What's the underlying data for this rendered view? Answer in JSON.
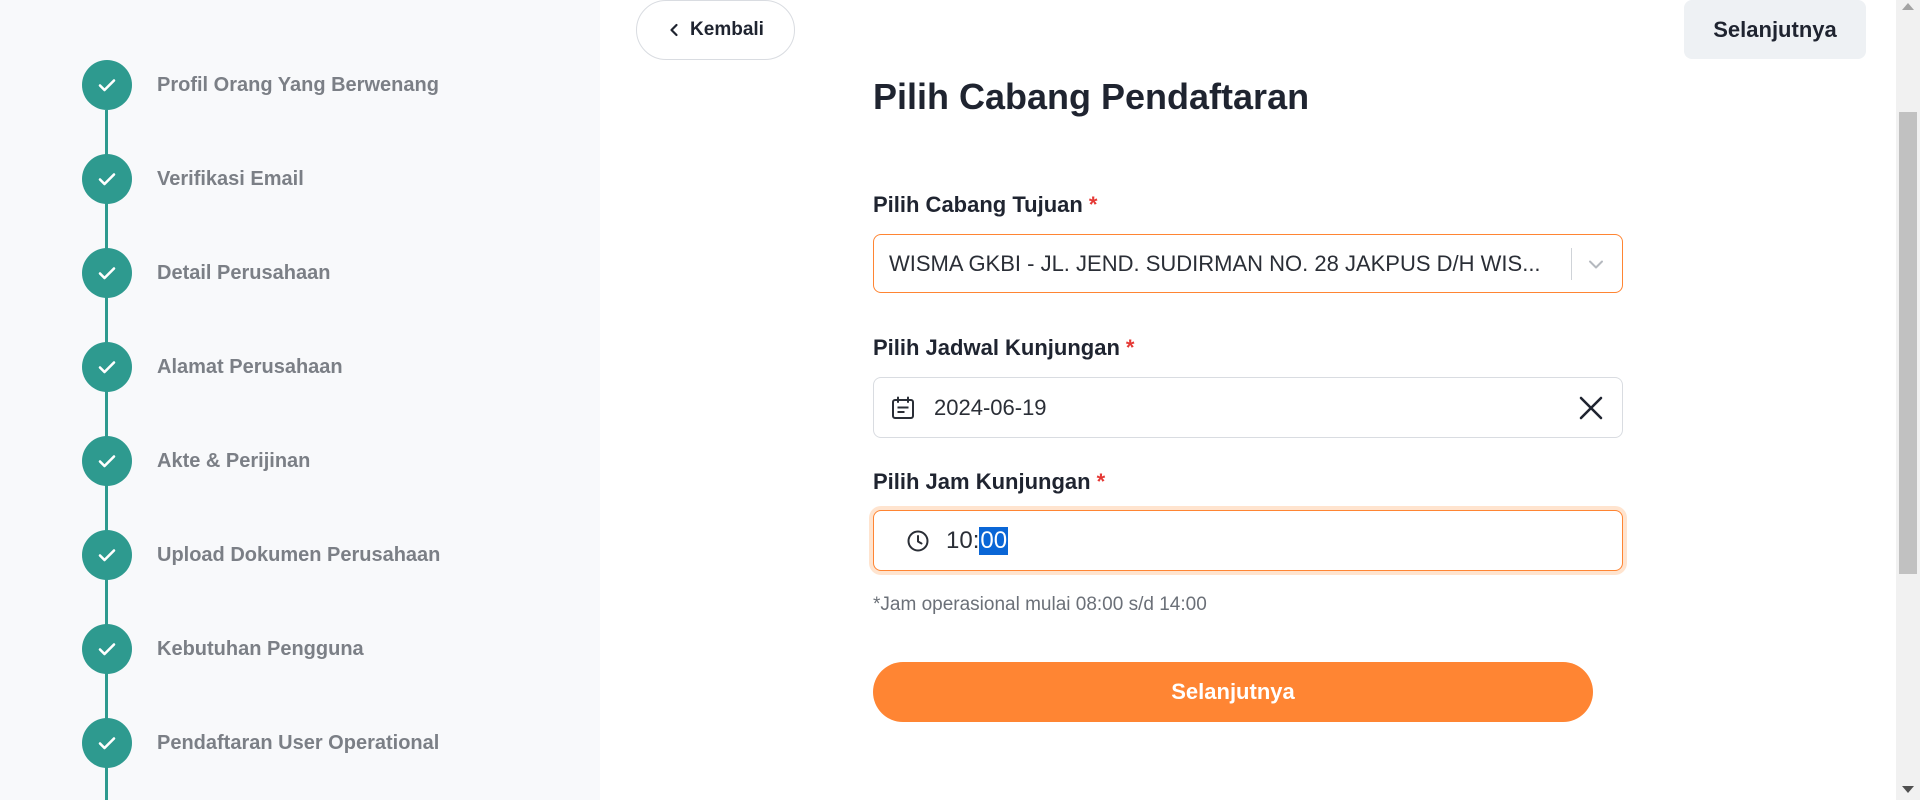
{
  "steps": [
    {
      "label": "Profil Orang Yang Berwenang",
      "status": "completed"
    },
    {
      "label": "Verifikasi Email",
      "status": "completed"
    },
    {
      "label": "Detail Perusahaan",
      "status": "completed"
    },
    {
      "label": "Alamat Perusahaan",
      "status": "completed"
    },
    {
      "label": "Akte & Perijinan",
      "status": "completed"
    },
    {
      "label": "Upload Dokumen Perusahaan",
      "status": "completed"
    },
    {
      "label": "Kebutuhan Pengguna",
      "status": "completed"
    },
    {
      "label": "Pendaftaran User Operational",
      "status": "completed"
    }
  ],
  "nav": {
    "back_label": "Kembali",
    "next_label": "Selanjutnya"
  },
  "form": {
    "title": "Pilih Cabang Pendaftaran",
    "branch": {
      "label": "Pilih Cabang Tujuan",
      "required": "*",
      "value": "WISMA GKBI - JL. JEND. SUDIRMAN NO. 28 JAKPUS D/H WIS..."
    },
    "schedule": {
      "label": "Pilih Jadwal Kunjungan",
      "required": "*",
      "value": "2024-06-19"
    },
    "time": {
      "label": "Pilih Jam Kunjungan",
      "required": "*",
      "hours": "10",
      "separator": ":",
      "minutes": "00"
    },
    "hint": "*Jam operasional mulai 08:00 s/d 14:00",
    "submit_label": "Selanjutnya"
  },
  "colors": {
    "accent": "#ff8533",
    "step_complete": "#2e9a8f",
    "required": "#e53935",
    "selection": "#0a66d6"
  },
  "icons": {
    "step": "check-icon",
    "back": "chevron-left-icon",
    "select": "chevron-down-icon",
    "date": "calendar-icon",
    "clear": "close-icon",
    "time": "clock-icon"
  }
}
